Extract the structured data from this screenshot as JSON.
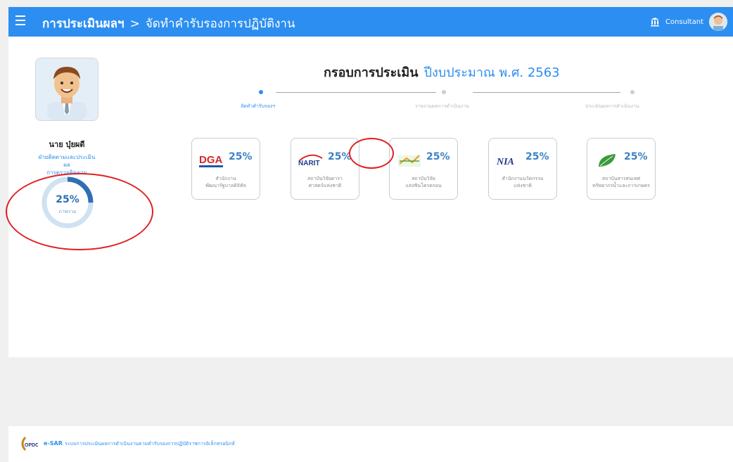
{
  "topbar": {
    "menu_icon": "hamburger-icon",
    "breadcrumb_main": "การประเมินผลฯ",
    "breadcrumb_sep": ">",
    "breadcrumb_sub": "จัดทำคำรับรองการปฏิบัติงาน",
    "role": "Consultant",
    "bg_color": "#2c8ef0"
  },
  "profile": {
    "name": "นาย บุ๋ยผดี",
    "dept_line1": "ฝ่ายติดตามและประเมินผล",
    "dept_line2": "การตรวจติดตาม",
    "progress_value": "25%",
    "progress_fraction": 0.25,
    "progress_sub": "ภาพรวม"
  },
  "title": {
    "label": "กรอบการประเมิน",
    "fiscal": "ปีงบประมาณ พ.ศ. 2563"
  },
  "stepper": {
    "steps": [
      "จัดทำคำรับรองฯ",
      "รายงานผลการดำเนินงาน",
      "ประเมินผลการดำเนินงาน"
    ],
    "active_index": 0
  },
  "cards": [
    {
      "logo": "DGA",
      "percent": "25%",
      "name_line1": "สำนักงาน",
      "name_line2": "พัฒนารัฐบาลดิจิทัล"
    },
    {
      "logo": "NARIT",
      "percent": "25%",
      "name_line1": "สถาบันวิจัยดารา",
      "name_line2": "ศาสตร์แห่งชาติ"
    },
    {
      "logo": "ST",
      "percent": "25%",
      "name_line1": "สถาบันวิจัย",
      "name_line2": "แสงซินโครตรอน"
    },
    {
      "logo": "NIA",
      "percent": "25%",
      "name_line1": "สำนักงานนวัตกรรม",
      "name_line2": "แห่งชาติ"
    },
    {
      "logo": "LEAF",
      "percent": "25%",
      "name_line1": "สถาบันสารสนเทศ",
      "name_line2": "ทรัพยากรน้ำและการเกษตร"
    }
  ],
  "footer": {
    "logo": "OPDC",
    "brand": "e-SAR",
    "description": "ระบบการประเมินผลการดำเนินงานตามคำรับรองการปฏิบัติราชการอิเล็กทรอนิกส์"
  }
}
